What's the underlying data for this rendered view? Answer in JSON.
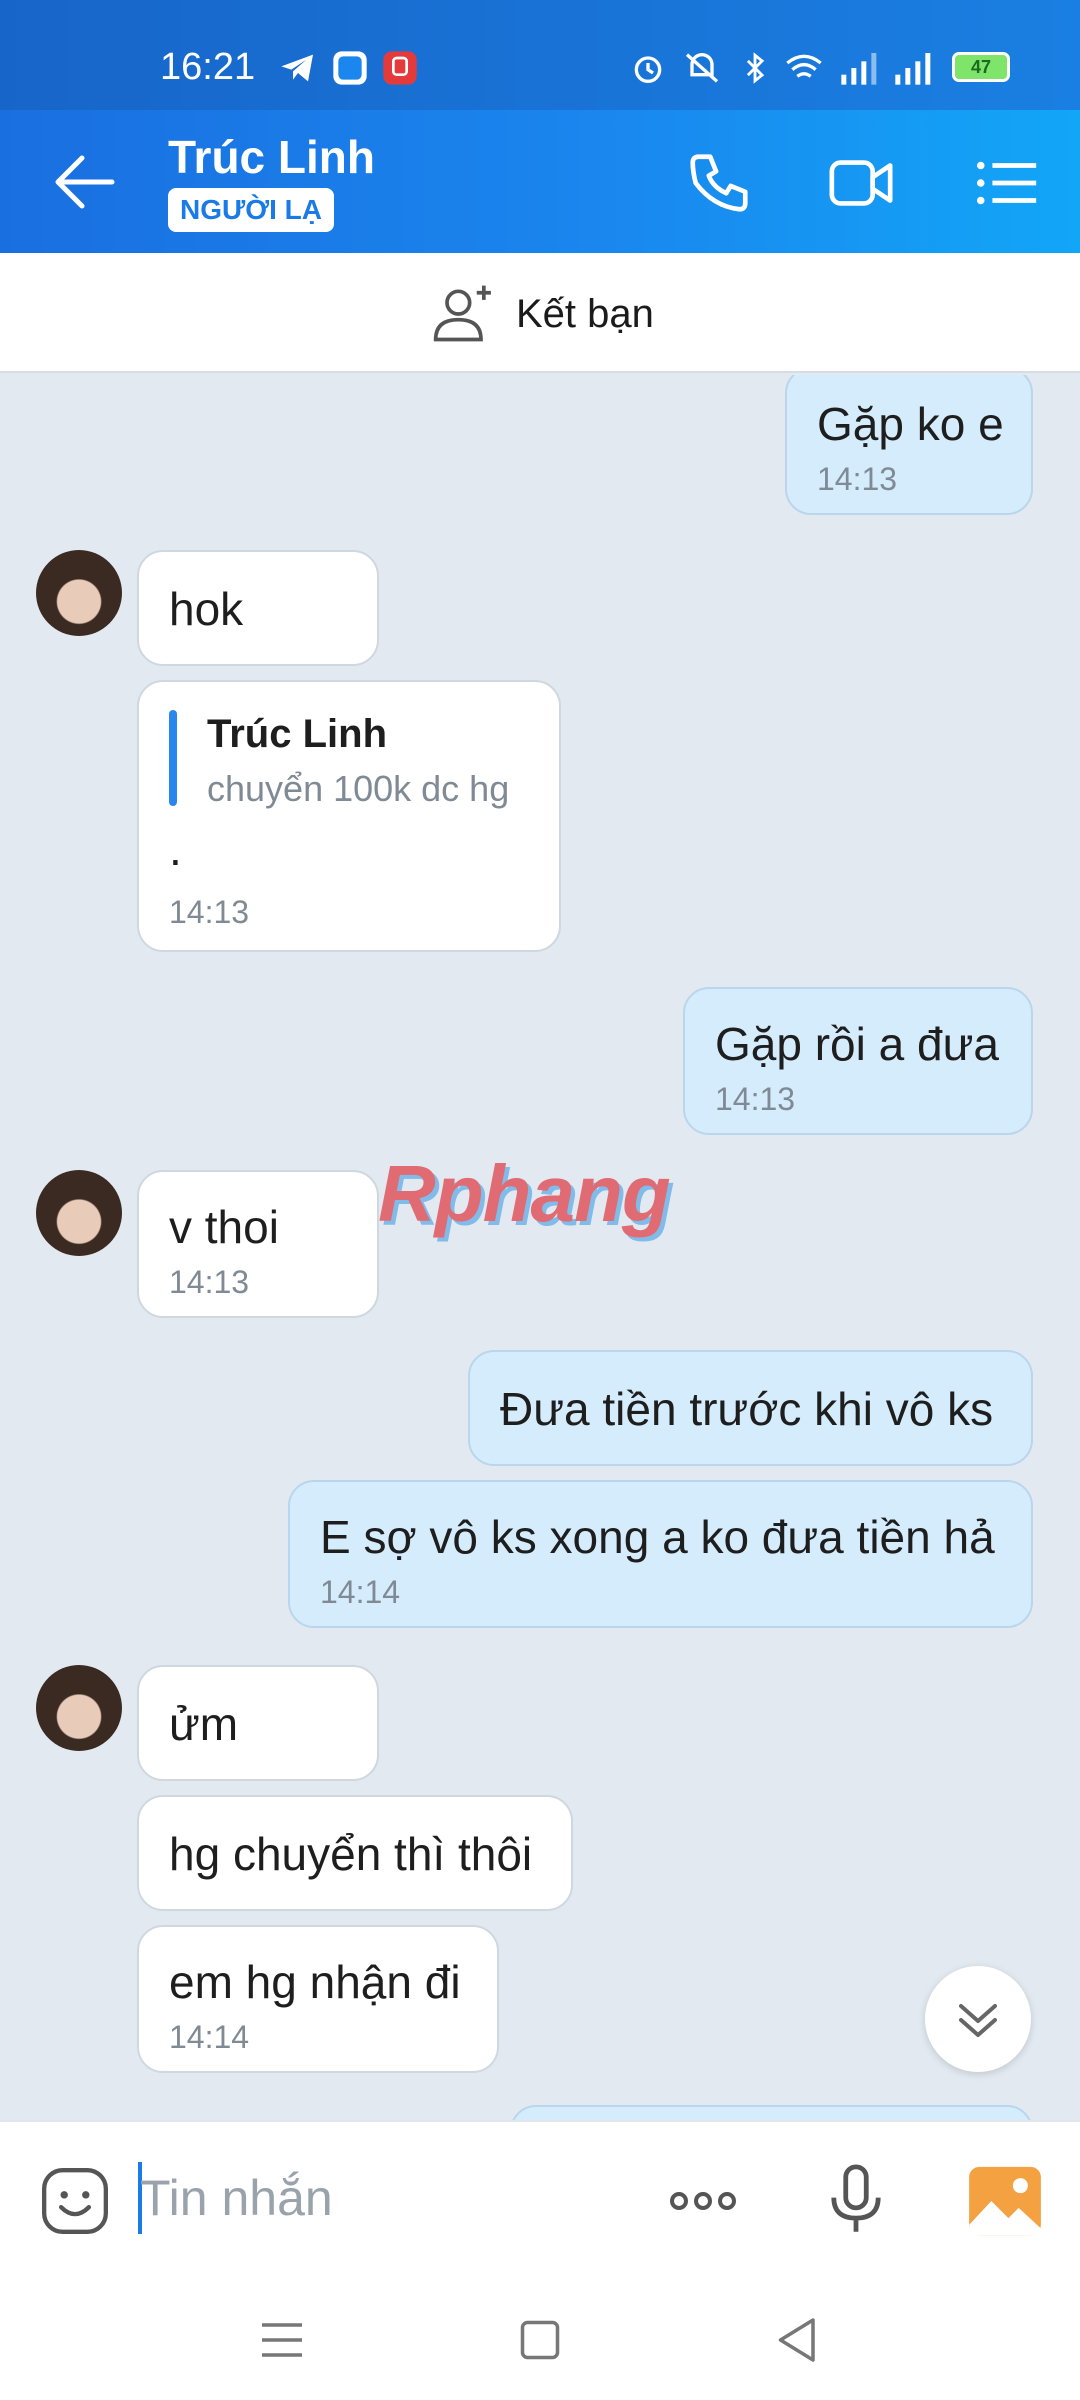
{
  "status_bar": {
    "time": "16:21",
    "battery": "47"
  },
  "header": {
    "contact_name": "Trúc Linh",
    "badge": "NGƯỜI LẠ"
  },
  "add_friend": {
    "label": "Kết bạn"
  },
  "messages": [
    {
      "side": "out",
      "text": "Gặp ko e",
      "time": "14:13"
    },
    {
      "side": "in",
      "text": "hok"
    },
    {
      "side": "in",
      "quote_title": "Trúc Linh",
      "quote_body": "chuyển 100k dc hg",
      "text": ".",
      "time": "14:13"
    },
    {
      "side": "out",
      "text": "Gặp rồi a đưa",
      "time": "14:13"
    },
    {
      "side": "in",
      "text": "v thoi",
      "time": "14:13"
    },
    {
      "side": "out",
      "text": "Đưa tiền trước khi vô ks"
    },
    {
      "side": "out",
      "text": "E sợ vô ks xong a ko đưa tiền hả",
      "time": "14:14"
    },
    {
      "side": "in",
      "text": "ửm"
    },
    {
      "side": "in",
      "text": "hg chuyển thì thôi"
    },
    {
      "side": "in",
      "text": "em hg nhận đi",
      "time": "14:14"
    }
  ],
  "watermark": "Rphang",
  "composer": {
    "placeholder": "Tin nhắn"
  },
  "colors": {
    "header_start": "#1a6fe0",
    "header_end": "#12a6f7",
    "outgoing_bubble": "#d5ecfc",
    "incoming_bubble": "#ffffff",
    "chat_background": "#e2e9f1"
  }
}
